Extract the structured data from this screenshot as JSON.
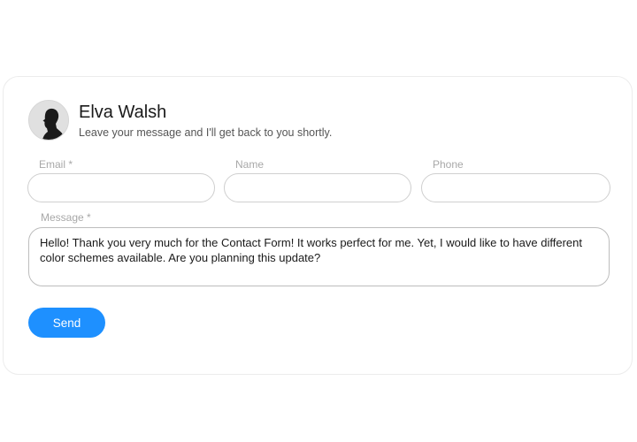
{
  "header": {
    "name": "Elva Walsh",
    "subtitle": "Leave your message and I'll get back to you shortly."
  },
  "avatar": {
    "icon": "person-silhouette-icon"
  },
  "form": {
    "email": {
      "label": "Email *",
      "value": "",
      "placeholder": ""
    },
    "name": {
      "label": "Name",
      "value": "",
      "placeholder": ""
    },
    "phone": {
      "label": "Phone",
      "value": "",
      "placeholder": ""
    },
    "message": {
      "label": "Message *",
      "value": "Hello! Thank you very much for the Contact Form! It works perfect for me. Yet, I would like to have different color schemes available. Are you planning this update?"
    },
    "send_label": "Send"
  },
  "colors": {
    "accent": "#1e90ff",
    "border": "#cfcfcf",
    "label": "#a8a8a8"
  }
}
